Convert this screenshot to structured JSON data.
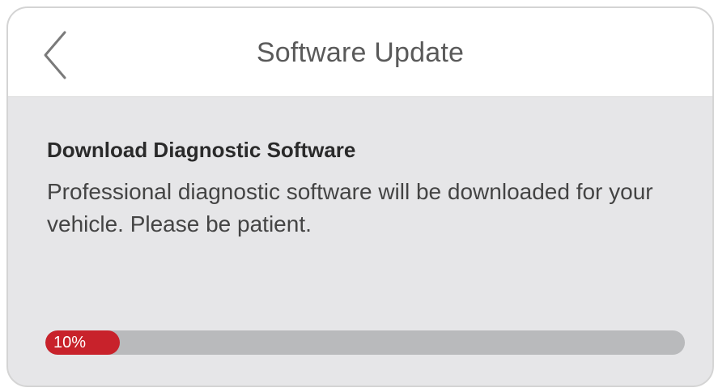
{
  "header": {
    "title": "Software Update",
    "back_icon": "chevron-left-icon"
  },
  "content": {
    "heading": "Download Diagnostic Software",
    "description": "Professional diagnostic software will be downloaded for your vehicle. Please be patient."
  },
  "progress": {
    "value_percent": 10,
    "label": "10%",
    "fill_color": "#c8222b",
    "track_color": "#b9babc"
  }
}
